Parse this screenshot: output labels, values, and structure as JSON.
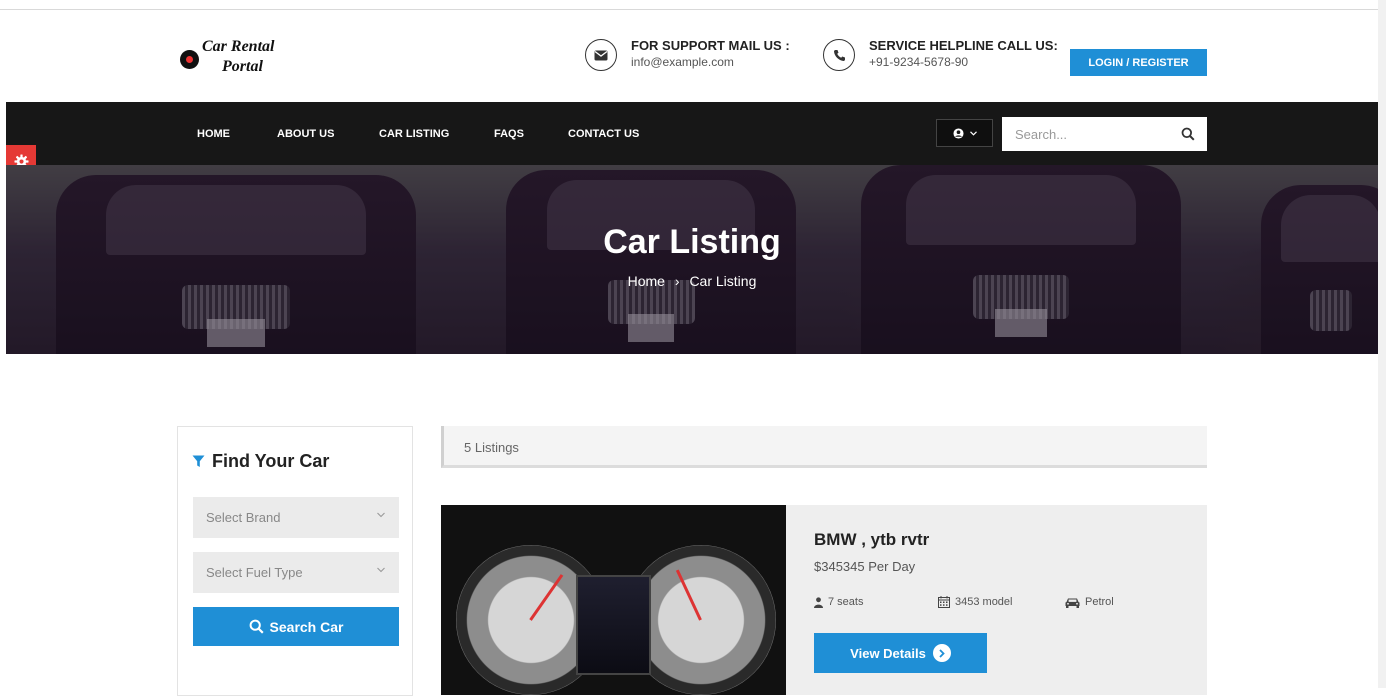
{
  "header": {
    "logo": {
      "line1": "Car Rental",
      "line2": "Portal"
    },
    "support": {
      "title": "FOR SUPPORT MAIL US :",
      "value": "info@example.com",
      "icon": "envelope-icon"
    },
    "helpline": {
      "title": "SERVICE HELPLINE CALL US:",
      "value": "+91-9234-5678-90",
      "icon": "phone-icon"
    },
    "login_label": "LOGIN / REGISTER"
  },
  "nav": {
    "items": [
      "HOME",
      "ABOUT US",
      "CAR LISTING",
      "FAQS",
      "CONTACT US"
    ],
    "user_icon": "user-circle-icon",
    "search_placeholder": "Search..."
  },
  "hero": {
    "title": "Car Listing",
    "breadcrumb": {
      "home": "Home",
      "separator": "›",
      "current": "Car Listing"
    }
  },
  "sidebar": {
    "title": "Find Your Car",
    "brand_select": "Select Brand",
    "fuel_select": "Select Fuel Type",
    "search_label": "Search Car"
  },
  "listings": {
    "count_label": "5 Listings",
    "items": [
      {
        "title": "BMW , ytb rvtr",
        "price": "$345345 Per Day",
        "seats": "7 seats",
        "model": "3453 model",
        "fuel": "Petrol",
        "view_label": "View Details"
      }
    ]
  },
  "colors": {
    "accent": "#1f8fd6",
    "nav_bg": "#171717",
    "gear_tab": "#e53935"
  }
}
